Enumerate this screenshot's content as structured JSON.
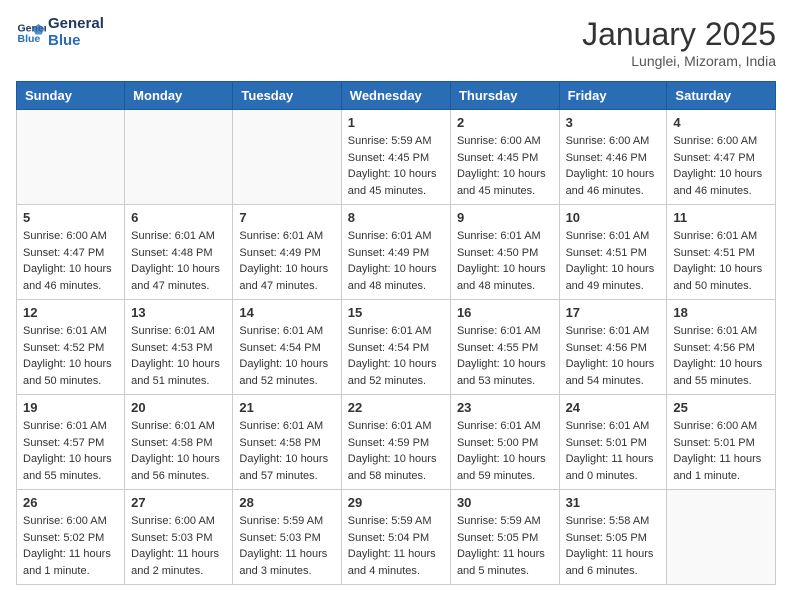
{
  "header": {
    "logo_line1": "General",
    "logo_line2": "Blue",
    "month": "January 2025",
    "location": "Lunglei, Mizoram, India"
  },
  "weekdays": [
    "Sunday",
    "Monday",
    "Tuesday",
    "Wednesday",
    "Thursday",
    "Friday",
    "Saturday"
  ],
  "weeks": [
    [
      {
        "day": "",
        "content": ""
      },
      {
        "day": "",
        "content": ""
      },
      {
        "day": "",
        "content": ""
      },
      {
        "day": "1",
        "content": "Sunrise: 5:59 AM\nSunset: 4:45 PM\nDaylight: 10 hours\nand 45 minutes."
      },
      {
        "day": "2",
        "content": "Sunrise: 6:00 AM\nSunset: 4:45 PM\nDaylight: 10 hours\nand 45 minutes."
      },
      {
        "day": "3",
        "content": "Sunrise: 6:00 AM\nSunset: 4:46 PM\nDaylight: 10 hours\nand 46 minutes."
      },
      {
        "day": "4",
        "content": "Sunrise: 6:00 AM\nSunset: 4:47 PM\nDaylight: 10 hours\nand 46 minutes."
      }
    ],
    [
      {
        "day": "5",
        "content": "Sunrise: 6:00 AM\nSunset: 4:47 PM\nDaylight: 10 hours\nand 46 minutes."
      },
      {
        "day": "6",
        "content": "Sunrise: 6:01 AM\nSunset: 4:48 PM\nDaylight: 10 hours\nand 47 minutes."
      },
      {
        "day": "7",
        "content": "Sunrise: 6:01 AM\nSunset: 4:49 PM\nDaylight: 10 hours\nand 47 minutes."
      },
      {
        "day": "8",
        "content": "Sunrise: 6:01 AM\nSunset: 4:49 PM\nDaylight: 10 hours\nand 48 minutes."
      },
      {
        "day": "9",
        "content": "Sunrise: 6:01 AM\nSunset: 4:50 PM\nDaylight: 10 hours\nand 48 minutes."
      },
      {
        "day": "10",
        "content": "Sunrise: 6:01 AM\nSunset: 4:51 PM\nDaylight: 10 hours\nand 49 minutes."
      },
      {
        "day": "11",
        "content": "Sunrise: 6:01 AM\nSunset: 4:51 PM\nDaylight: 10 hours\nand 50 minutes."
      }
    ],
    [
      {
        "day": "12",
        "content": "Sunrise: 6:01 AM\nSunset: 4:52 PM\nDaylight: 10 hours\nand 50 minutes."
      },
      {
        "day": "13",
        "content": "Sunrise: 6:01 AM\nSunset: 4:53 PM\nDaylight: 10 hours\nand 51 minutes."
      },
      {
        "day": "14",
        "content": "Sunrise: 6:01 AM\nSunset: 4:54 PM\nDaylight: 10 hours\nand 52 minutes."
      },
      {
        "day": "15",
        "content": "Sunrise: 6:01 AM\nSunset: 4:54 PM\nDaylight: 10 hours\nand 52 minutes."
      },
      {
        "day": "16",
        "content": "Sunrise: 6:01 AM\nSunset: 4:55 PM\nDaylight: 10 hours\nand 53 minutes."
      },
      {
        "day": "17",
        "content": "Sunrise: 6:01 AM\nSunset: 4:56 PM\nDaylight: 10 hours\nand 54 minutes."
      },
      {
        "day": "18",
        "content": "Sunrise: 6:01 AM\nSunset: 4:56 PM\nDaylight: 10 hours\nand 55 minutes."
      }
    ],
    [
      {
        "day": "19",
        "content": "Sunrise: 6:01 AM\nSunset: 4:57 PM\nDaylight: 10 hours\nand 55 minutes."
      },
      {
        "day": "20",
        "content": "Sunrise: 6:01 AM\nSunset: 4:58 PM\nDaylight: 10 hours\nand 56 minutes."
      },
      {
        "day": "21",
        "content": "Sunrise: 6:01 AM\nSunset: 4:58 PM\nDaylight: 10 hours\nand 57 minutes."
      },
      {
        "day": "22",
        "content": "Sunrise: 6:01 AM\nSunset: 4:59 PM\nDaylight: 10 hours\nand 58 minutes."
      },
      {
        "day": "23",
        "content": "Sunrise: 6:01 AM\nSunset: 5:00 PM\nDaylight: 10 hours\nand 59 minutes."
      },
      {
        "day": "24",
        "content": "Sunrise: 6:01 AM\nSunset: 5:01 PM\nDaylight: 11 hours\nand 0 minutes."
      },
      {
        "day": "25",
        "content": "Sunrise: 6:00 AM\nSunset: 5:01 PM\nDaylight: 11 hours\nand 1 minute."
      }
    ],
    [
      {
        "day": "26",
        "content": "Sunrise: 6:00 AM\nSunset: 5:02 PM\nDaylight: 11 hours\nand 1 minute."
      },
      {
        "day": "27",
        "content": "Sunrise: 6:00 AM\nSunset: 5:03 PM\nDaylight: 11 hours\nand 2 minutes."
      },
      {
        "day": "28",
        "content": "Sunrise: 5:59 AM\nSunset: 5:03 PM\nDaylight: 11 hours\nand 3 minutes."
      },
      {
        "day": "29",
        "content": "Sunrise: 5:59 AM\nSunset: 5:04 PM\nDaylight: 11 hours\nand 4 minutes."
      },
      {
        "day": "30",
        "content": "Sunrise: 5:59 AM\nSunset: 5:05 PM\nDaylight: 11 hours\nand 5 minutes."
      },
      {
        "day": "31",
        "content": "Sunrise: 5:58 AM\nSunset: 5:05 PM\nDaylight: 11 hours\nand 6 minutes."
      },
      {
        "day": "",
        "content": ""
      }
    ]
  ]
}
